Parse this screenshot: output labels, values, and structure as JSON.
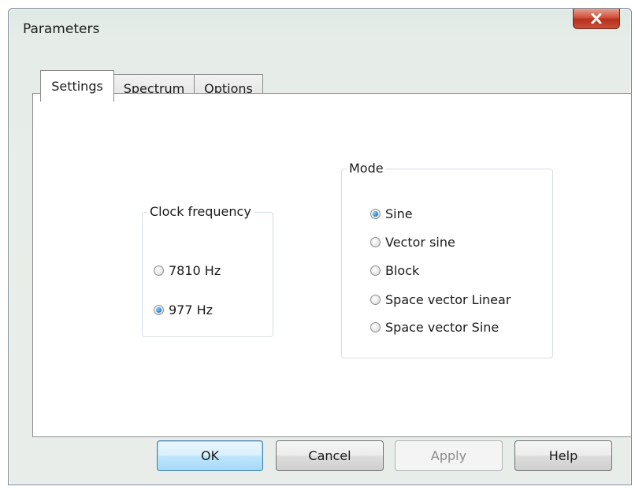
{
  "window": {
    "title": "Parameters",
    "close_label": "X"
  },
  "tabs": [
    {
      "label": "Settings",
      "active": true
    },
    {
      "label": "Spectrum",
      "active": false
    },
    {
      "label": "Options",
      "active": false
    }
  ],
  "clock_frequency": {
    "legend": "Clock frequency",
    "options": [
      {
        "label": "7810 Hz",
        "checked": false
      },
      {
        "label": "977 Hz",
        "checked": true
      }
    ]
  },
  "mode": {
    "legend": "Mode",
    "options": [
      {
        "label": "Sine",
        "checked": true
      },
      {
        "label": "Vector sine",
        "checked": false
      },
      {
        "label": "Block",
        "checked": false
      },
      {
        "label": "Space vector Linear",
        "checked": false
      },
      {
        "label": "Space vector Sine",
        "checked": false
      }
    ]
  },
  "buttons": {
    "ok": "OK",
    "cancel": "Cancel",
    "apply": "Apply",
    "help": "Help"
  },
  "colors": {
    "default_button_border": "#3c7fb1",
    "close_button": "#c8503a",
    "radio_checked": "#2a8fd6"
  }
}
